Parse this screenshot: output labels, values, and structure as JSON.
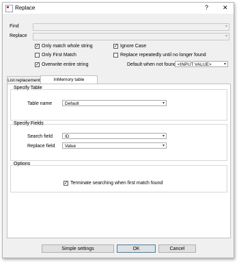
{
  "window": {
    "title": "Replace",
    "help_glyph": "?",
    "close_glyph": "✕"
  },
  "find": {
    "label": "Find",
    "value": ""
  },
  "replace": {
    "label": "Replace",
    "value": ""
  },
  "options": {
    "only_match_whole_string": {
      "label": "Only match whole string",
      "checked": true
    },
    "ignore_case": {
      "label": "Ignore Case",
      "checked": true
    },
    "only_first_match": {
      "label": "Only First Match",
      "checked": false
    },
    "replace_repeatedly": {
      "label": "Replace repeatedly until no longer found",
      "checked": false
    },
    "overwrite_entire_string": {
      "label": "Overwrite entire string",
      "checked": true
    },
    "default_when_not_found": {
      "label": "Default when not found",
      "value": "<INPUT VALUE>"
    }
  },
  "tabs": [
    {
      "label": "List replacement",
      "active": false
    },
    {
      "label": "InMemory table replacement",
      "active": true
    }
  ],
  "specify_table": {
    "title": "Specify Table",
    "table_name_label": "Table name",
    "table_name_value": "Default"
  },
  "specify_fields": {
    "title": "Specify Fields",
    "search_field_label": "Search field",
    "search_field_value": "ID",
    "replace_field_label": "Replace field",
    "replace_field_value": "Value"
  },
  "options_group": {
    "title": "Options",
    "terminate_label": "Terminate searching when first match found",
    "terminate_checked": true
  },
  "footer": {
    "simple_settings": "Simple settings",
    "ok": "OK",
    "cancel": "Cancel"
  },
  "icons": {
    "check": "✓",
    "dropdown": "▾"
  }
}
